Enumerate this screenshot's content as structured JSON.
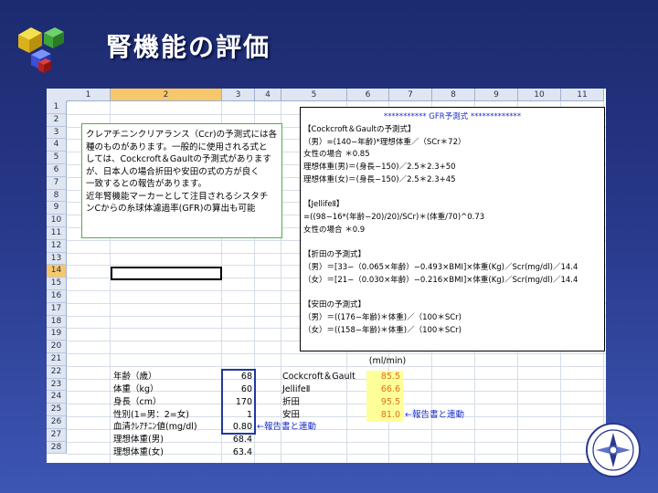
{
  "title": "腎機能の評価",
  "columns": [
    "1",
    "2",
    "3",
    "4",
    "5",
    "6",
    "7",
    "8",
    "9",
    "10",
    "11"
  ],
  "rows": [
    "1",
    "2",
    "3",
    "4",
    "5",
    "6",
    "7",
    "8",
    "9",
    "10",
    "11",
    "12",
    "13",
    "14",
    "15",
    "16",
    "17",
    "18",
    "19",
    "20",
    "21",
    "22",
    "23",
    "24",
    "25",
    "26",
    "27",
    "28"
  ],
  "note_lines": [
    "クレアチニンクリアランス（Ccr)の予測式には各",
    "種のものがあります。一般的に使用される式と",
    "しては、Cockcroft＆Gaultの予測式があります",
    "が、日本人の場合折田や安田の式の方が良く",
    "一致するとの報告があります。",
    "近年腎機能マーカーとして注目されるシスタチ",
    "ンCからの糸球体濾過率(GFR)の算出も可能"
  ],
  "formula_lines": [
    "***********    GFR予測式    *************",
    "【Cockcroft＆Gaultの予測式】",
    "（男）=(140−年齢)*理想体重／（SCr＊72）",
    "女性の場合  ＊0.85",
    "理想体重(男)＝(身長−150)／2.5＊2.3+50",
    "理想体重(女)＝(身長−150)／2.5＊2.3+45",
    "",
    "【JellifeⅡ】",
    "=((98−16*(年齢−20)/20)/SCr)＊(体重/70)^0.73",
    "女性の場合  ＊0.9",
    "",
    "【折田の予測式】",
    "（男）＝[33−（0.065×年齢）−0.493×BMI]×体重(Kg)／Scr(mg/dl)／14.4",
    "（女）＝[21−（0.030×年齢）−0.216×BMI]×体重(Kg)／Scr(mg/dl)／14.4",
    "",
    "【安田の予測式】",
    "（男）＝((176−年齢)＊体重)／（100＊SCr)",
    "（女）＝((158−年齢)＊体重)／（100＊SCr)"
  ],
  "unit_label": "(ml/min)",
  "inputs": [
    {
      "label": "年齢（歳）",
      "value": "68"
    },
    {
      "label": "体重（kg）",
      "value": "60"
    },
    {
      "label": "身長（cm）",
      "value": "170"
    },
    {
      "label": "性別(1=男：2=女)",
      "value": "1"
    },
    {
      "label": "血清ｸﾚｱﾁﾆﾝ値(mg/dl)",
      "value": "0.80"
    },
    {
      "label": "理想体重(男)",
      "value": "68.4"
    },
    {
      "label": "理想体重(女)",
      "value": "63.4"
    }
  ],
  "results": [
    {
      "method": "Cockcroft＆Gault",
      "value": "85.5"
    },
    {
      "method": "JellifeⅡ",
      "value": "66.6"
    },
    {
      "method": "折田",
      "value": "95.5"
    },
    {
      "method": "安田",
      "value": "81.0"
    }
  ],
  "link_note_1": "←報告書と連動",
  "link_note_2": "←報告書と連動",
  "colors": {
    "accent_yellow": "#ffff99",
    "result_orange": "#e0701a",
    "link_blue": "#1a2dc9"
  },
  "icons": [
    "cubes-logo-icon",
    "compass-badge-icon"
  ]
}
